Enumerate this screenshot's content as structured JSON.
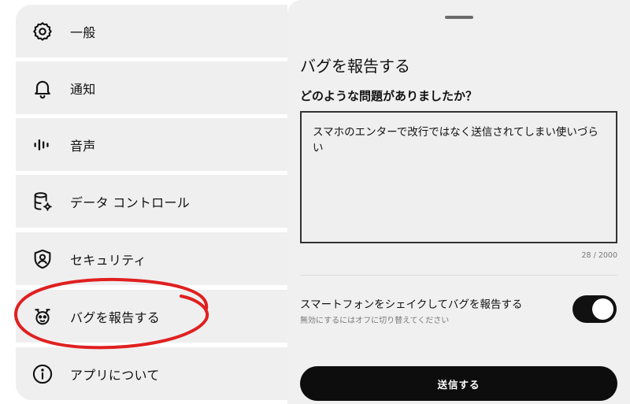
{
  "settings": {
    "items": [
      {
        "label": "一般",
        "icon": "gear-icon"
      },
      {
        "label": "通知",
        "icon": "bell-icon"
      },
      {
        "label": "音声",
        "icon": "waveform-icon"
      },
      {
        "label": "データ コントロール",
        "icon": "database-settings-icon"
      },
      {
        "label": "セキュリティ",
        "icon": "shield-user-icon"
      },
      {
        "label": "バグを報告する",
        "icon": "bug-icon"
      },
      {
        "label": "アプリについて",
        "icon": "info-icon"
      }
    ]
  },
  "annotation": {
    "color": "#e02020"
  },
  "bug_report": {
    "title": "バグを報告する",
    "question": "どのような問題がありましたか？",
    "feedback_text": "スマホのエンターで改行ではなく送信されてしまい使いづらい",
    "char_count": "28 / 2000",
    "shake_label": "スマートフォンをシェイクしてバグを報告する",
    "shake_sublabel": "無効にするにはオフに切り替えてください",
    "shake_enabled": true,
    "submit_label": "送信する"
  }
}
